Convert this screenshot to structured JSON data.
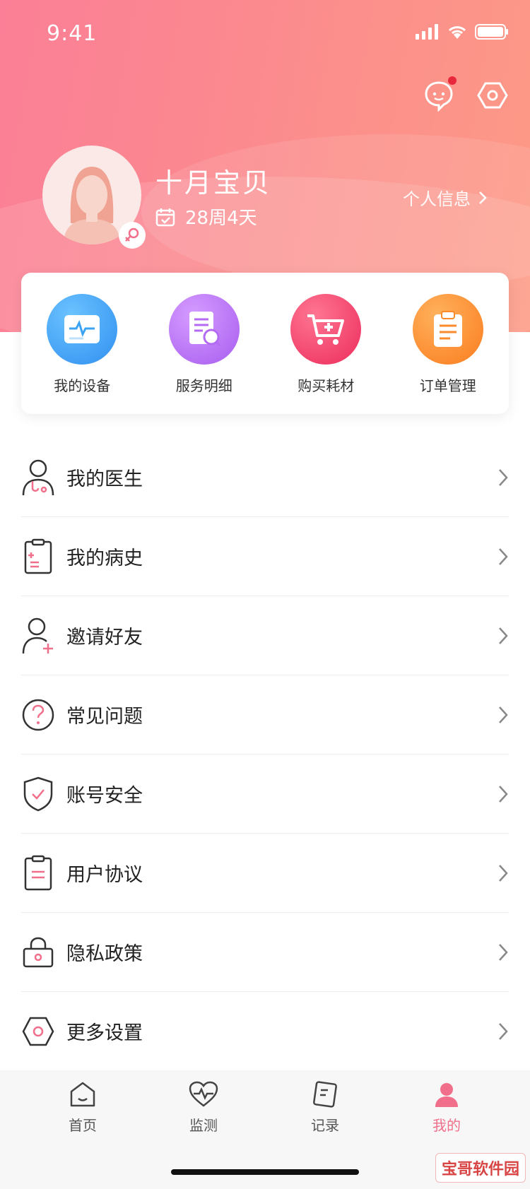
{
  "status_bar": {
    "time": "9:41"
  },
  "profile": {
    "name": "十月宝贝",
    "pregnancy_week": "28周4天",
    "info_link": "个人信息"
  },
  "quick_actions": [
    {
      "label": "我的设备",
      "icon": "monitor-icon",
      "color": "#3aa3f3"
    },
    {
      "label": "服务明细",
      "icon": "document-search-icon",
      "color": "#b46af2"
    },
    {
      "label": "购买耗材",
      "icon": "cart-icon",
      "color": "#f2436f"
    },
    {
      "label": "订单管理",
      "icon": "clipboard-icon",
      "color": "#fb8a2b"
    }
  ],
  "menu": [
    {
      "label": "我的医生",
      "icon": "doctor-icon"
    },
    {
      "label": "我的病史",
      "icon": "medical-record-icon"
    },
    {
      "label": "邀请好友",
      "icon": "add-user-icon"
    },
    {
      "label": "常见问题",
      "icon": "question-icon"
    },
    {
      "label": "账号安全",
      "icon": "shield-icon"
    },
    {
      "label": "用户协议",
      "icon": "agreement-icon"
    },
    {
      "label": "隐私政策",
      "icon": "lock-icon"
    },
    {
      "label": "更多设置",
      "icon": "settings-icon"
    }
  ],
  "tabs": [
    {
      "label": "首页",
      "icon": "home-icon"
    },
    {
      "label": "监测",
      "icon": "heart-monitor-icon"
    },
    {
      "label": "记录",
      "icon": "notebook-icon"
    },
    {
      "label": "我的",
      "icon": "profile-icon",
      "active": true
    }
  ],
  "watermark": "宝哥软件园",
  "colors": {
    "accent": "#f16f8b",
    "header_start": "#fb7f96",
    "header_end": "#fd9a86"
  }
}
